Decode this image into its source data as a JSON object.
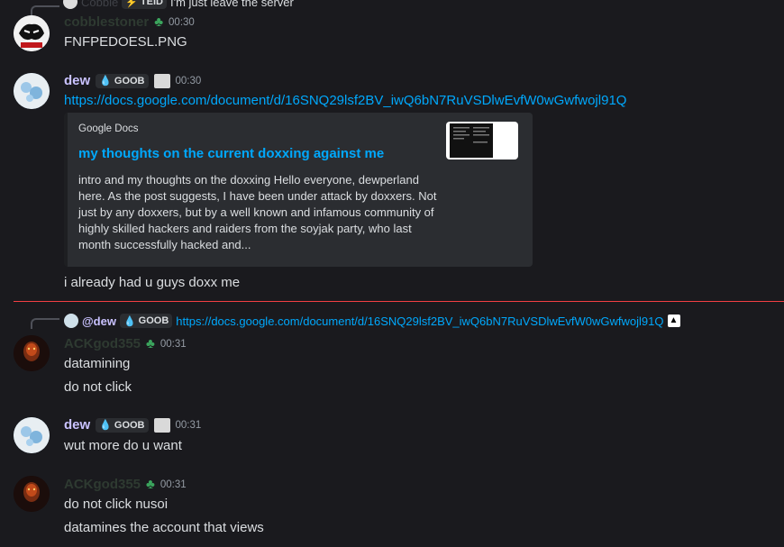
{
  "top_reply": {
    "username": "Cobble",
    "tag": "TEID",
    "text": "I'm just leave the server"
  },
  "messages": [
    {
      "username": "cobblestoner",
      "time": "00:30",
      "text": "FNFPEDOESL.PNG"
    },
    {
      "username": "dew",
      "tag": "GOOB",
      "time": "00:30",
      "link": "https://docs.google.com/document/d/16SNQ29lsf2BV_iwQ6bN7RuVSDlwEvfW0wGwfwojl91Q",
      "embed": {
        "provider": "Google Docs",
        "title": "my thoughts on the current doxxing against me",
        "description": "intro and my thoughts on the doxxing Hello everyone, dewperland here. As the post suggests, I have been under attack by doxxers. Not just by any doxxers, but by a well known and infamous community of highly skilled hackers and raiders from the soyjak party, who last month successfully hacked and..."
      },
      "followup": "i already had u guys doxx me"
    },
    {
      "reply": {
        "username": "@dew",
        "tag": "GOOB",
        "text": "https://docs.google.com/document/d/16SNQ29lsf2BV_iwQ6bN7RuVSDlwEvfW0wGwfwojl91Q"
      },
      "username": "ACKgod355",
      "time": "00:31",
      "lines": [
        "datamining",
        "do not click"
      ]
    },
    {
      "username": "dew",
      "tag": "GOOB",
      "time": "00:31",
      "lines": [
        "wut more do u want"
      ]
    },
    {
      "username": "ACKgod355",
      "time": "00:31",
      "lines": [
        "do not click nusoi",
        "datamines the account that views"
      ]
    }
  ],
  "colors": {
    "background": "#1a1a1e",
    "link": "#00a8fc",
    "new_divider": "#f23f43",
    "dew_name": "#c9c2ff",
    "muted_name": "#2e3a31"
  },
  "icons": [
    "clover-icon",
    "droplet-icon",
    "bolt-icon",
    "image-icon"
  ]
}
